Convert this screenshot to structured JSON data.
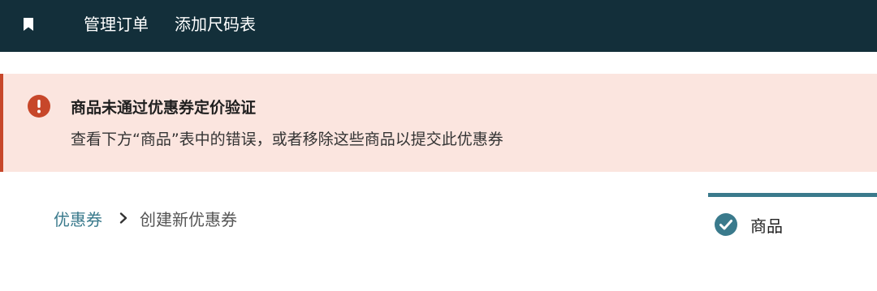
{
  "topbar": {
    "logo_icon": "bookmark-icon",
    "nav": [
      {
        "label": "管理订单"
      },
      {
        "label": "添加尺码表"
      }
    ]
  },
  "alert": {
    "icon": "error-icon",
    "color": "#c7472a",
    "background": "#fbe5df",
    "title": "商品未通过优惠券定价验证",
    "description": "查看下方“商品”表中的错误，或者移除这些商品以提交此优惠券"
  },
  "breadcrumb": {
    "parent": "优惠券",
    "separator_icon": "chevron-right-icon",
    "current": "创建新优惠券"
  },
  "steps": {
    "accent": "#3a7a8c",
    "items": [
      {
        "label": "商品",
        "icon": "check-circle-icon",
        "status": "complete"
      }
    ]
  }
}
